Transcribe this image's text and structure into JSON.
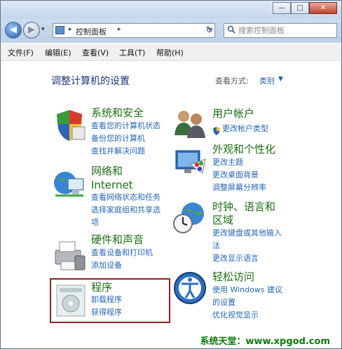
{
  "address_bar": {
    "crumb": "控制面板",
    "sep1": "▸",
    "sep2": "▸",
    "dropdown": "▾"
  },
  "nav": {
    "back": "◀",
    "forward": "▶",
    "dropdown": "▾",
    "refresh": "↻"
  },
  "search": {
    "placeholder": "搜索控制面板"
  },
  "window_controls": {
    "minimize": "—",
    "maximize": "□",
    "close": "✕"
  },
  "menu": [
    "文件(F)",
    "编辑(E)",
    "查看(V)",
    "工具(T)",
    "帮助(H)"
  ],
  "page": {
    "title": "调整计算机的设置",
    "view_label": "查看方式:",
    "view_value": "类别",
    "view_caret": "▼"
  },
  "categories": [
    {
      "title": "系统和安全",
      "icon": "shield-icon",
      "links": [
        "查看您的计算机状态",
        "备份您的计算机",
        "查找并解决问题"
      ]
    },
    {
      "title": "网络和",
      "title2": "Internet",
      "icon": "globe-network-icon",
      "links": [
        "查看网络状态和任务",
        "选择家庭组和共享选",
        "项"
      ]
    },
    {
      "title": "硬件和声音",
      "icon": "printer-icon",
      "links": [
        "查看设备和打印机",
        "添加设备"
      ]
    },
    {
      "title": "程序",
      "icon": "programs-icon",
      "links": [
        "卸载程序",
        "获得程序"
      ]
    },
    {
      "title": "用户帐户",
      "icon": "users-icon",
      "links": [
        "更改帐户类型"
      ]
    },
    {
      "title": "外观和个性化",
      "icon": "monitor-palette-icon",
      "links": [
        "更改主题",
        "更改桌面背景",
        "调整屏幕分辨率"
      ]
    },
    {
      "title": "时钟、语言和",
      "title2": "区域",
      "icon": "clock-globe-icon",
      "links": [
        "更改键盘或其他输入",
        "法",
        "更改显示语言"
      ]
    },
    {
      "title": "轻松访问",
      "icon": "ease-of-access-icon",
      "links": [
        "使用 Windows 建议",
        "的设置",
        "优化视觉显示"
      ]
    }
  ],
  "watermark": "系统天堂：www.xpgod.com"
}
